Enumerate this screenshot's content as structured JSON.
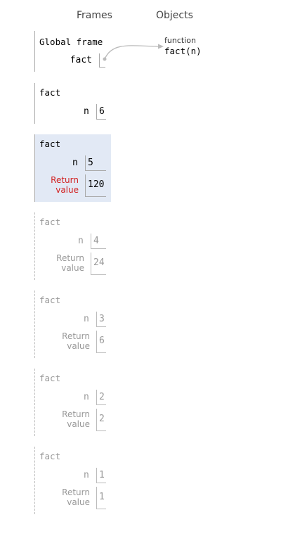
{
  "headers": {
    "frames": "Frames",
    "objects": "Objects"
  },
  "global_frame": {
    "title": "Global frame",
    "var_name": "fact"
  },
  "object": {
    "type": "function",
    "name": "fact(n)"
  },
  "frames": [
    {
      "title": "fact",
      "n": "6"
    },
    {
      "title": "fact",
      "n": "5",
      "return_label": "Return value",
      "return_value": "120"
    },
    {
      "title": "fact",
      "n": "4",
      "return_label": "Return value",
      "return_value": "24"
    },
    {
      "title": "fact",
      "n": "3",
      "return_label": "Return value",
      "return_value": "6"
    },
    {
      "title": "fact",
      "n": "2",
      "return_label": "Return value",
      "return_value": "2"
    },
    {
      "title": "fact",
      "n": "1",
      "return_label": "Return value",
      "return_value": "1"
    }
  ],
  "colors": {
    "active_frame_bg": "#e2e9f5",
    "return_label_active": "#d22222",
    "inactive_text": "#999999"
  }
}
